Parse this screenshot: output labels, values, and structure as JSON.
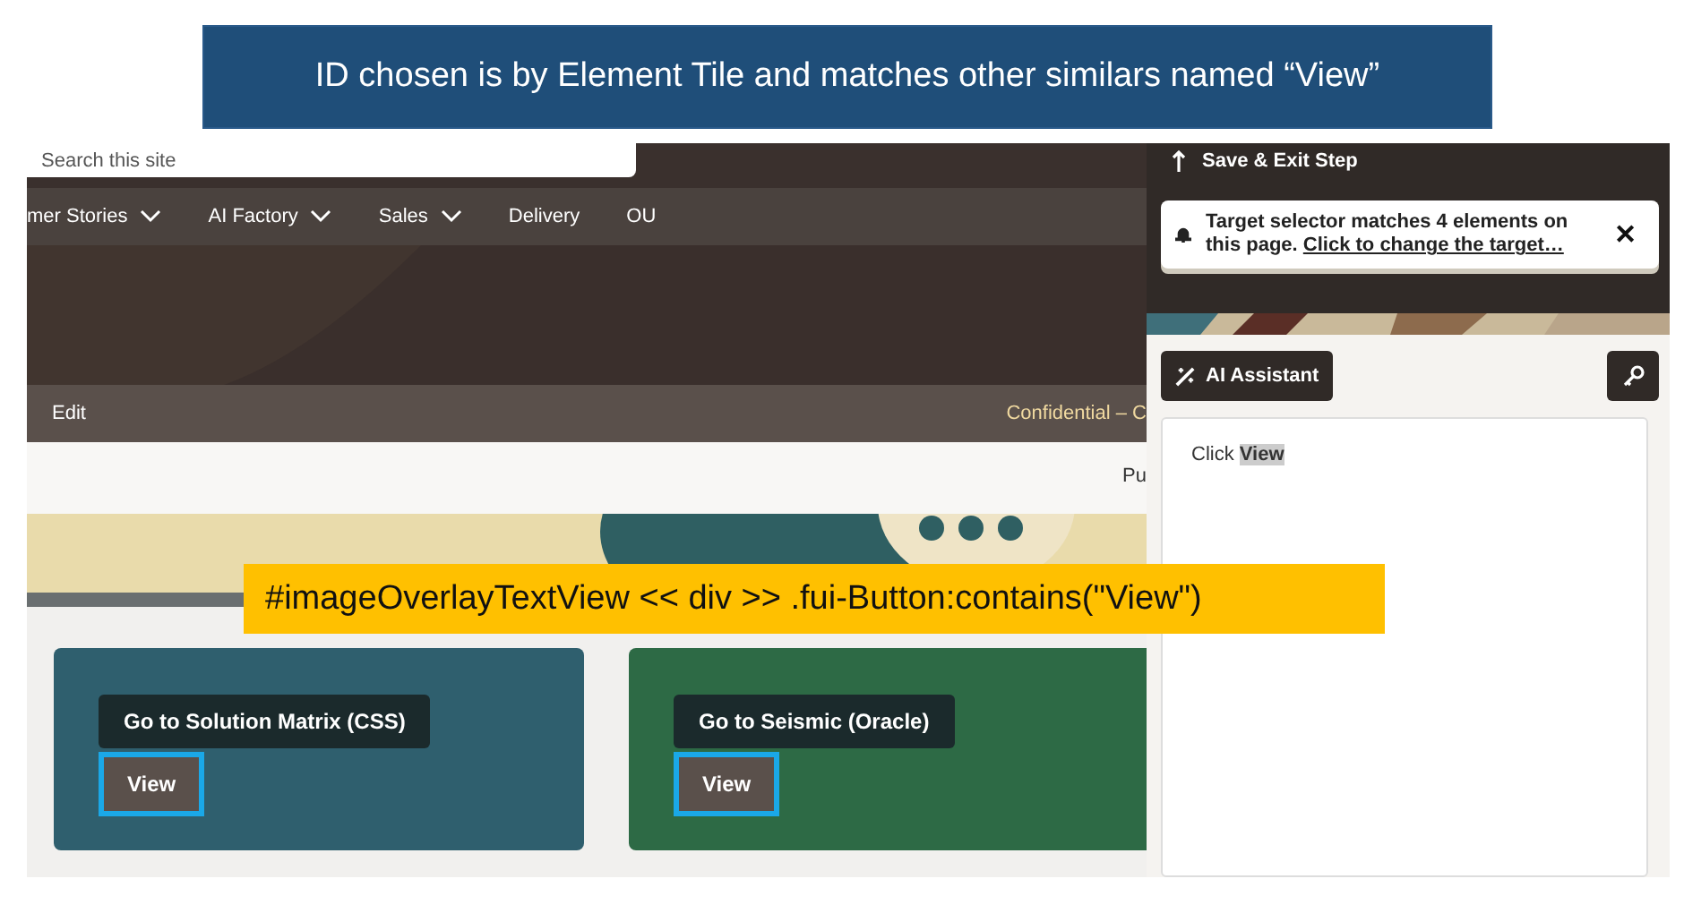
{
  "callout_top": {
    "text": "ID chosen is by Element Tile and matches other similars named “View”"
  },
  "callout_selector": {
    "text": "#imageOverlayTextView << div >> .fui-Button:contains(\"View\")"
  },
  "site": {
    "search": {
      "placeholder": "Search this site"
    },
    "nav": [
      {
        "label": "mer Stories",
        "dropdown": true
      },
      {
        "label": "AI Factory",
        "dropdown": true
      },
      {
        "label": "Sales",
        "dropdown": true
      },
      {
        "label": "Delivery",
        "dropdown": false
      },
      {
        "label": "OU",
        "dropdown": false
      }
    ],
    "edit_bar": {
      "edit": "Edit",
      "classification": "Confidential – C"
    },
    "sub_bar": {
      "right": "Pu"
    },
    "tiles": [
      {
        "title": "Go to Solution Matrix (CSS)",
        "button": "View",
        "color": "#2f5f6e",
        "highlighted": true
      },
      {
        "title": "Go to Seismic (Oracle)",
        "button": "View",
        "color": "#2d6a45",
        "highlighted": true
      }
    ]
  },
  "panel": {
    "save_exit": "Save & Exit Step",
    "notice": {
      "message": "Target selector matches 4 elements on this page.",
      "link": "Click to change the target…",
      "close": "✕"
    },
    "assistant_button": "AI Assistant",
    "step": {
      "prefix": "Click",
      "target": "View"
    }
  }
}
